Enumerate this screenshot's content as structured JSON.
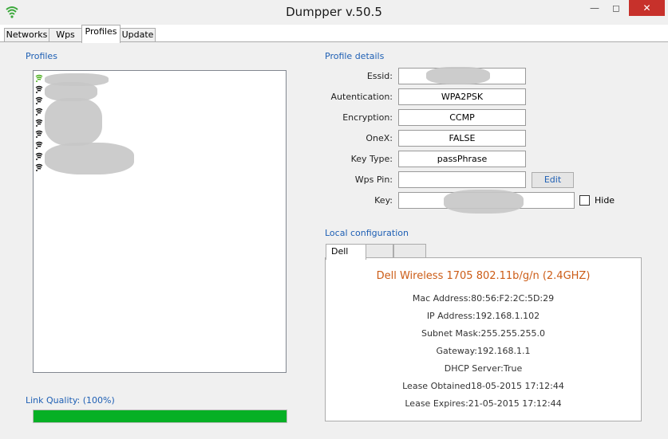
{
  "window": {
    "title": "Dumpper v.50.5",
    "min_glyph": "—",
    "max_glyph": "◻",
    "close_glyph": "✕",
    "app_icon": "wifi-signal-icon"
  },
  "tabs": [
    {
      "label": "Networks",
      "active": false
    },
    {
      "label": "Wps",
      "active": false
    },
    {
      "label": "Profiles",
      "active": true
    },
    {
      "label": "Update",
      "active": false
    }
  ],
  "profiles": {
    "label": "Profiles",
    "item_icon": "wifi-signal-icon",
    "items_count_visible": 9
  },
  "profile_details": {
    "label": "Profile details",
    "fields": [
      {
        "label": "Essid:",
        "value": ""
      },
      {
        "label": "Autentication:",
        "value": "WPA2PSK"
      },
      {
        "label": "Encryption:",
        "value": "CCMP"
      },
      {
        "label": "OneX:",
        "value": "FALSE"
      },
      {
        "label": "Key Type:",
        "value": "passPhrase"
      },
      {
        "label": "Wps Pin:",
        "value": ""
      },
      {
        "label": "Key:",
        "value": ""
      }
    ],
    "edit_label": "Edit",
    "hide_label": "Hide"
  },
  "local_config": {
    "label": "Local configuration",
    "tabs": [
      "Dell",
      "",
      ""
    ],
    "adapter": "Dell Wireless 1705 802.11b/g/n (2.4GHZ)",
    "rows": [
      "Mac Address:80:56:F2:2C:5D:29",
      "IP Address:192.168.1.102",
      "Subnet Mask:255.255.255.0",
      "Gateway:192.168.1.1",
      "DHCP Server:True",
      "Lease Obtained18-05-2015 17:12:44",
      "Lease Expires:21-05-2015 17:12:44"
    ]
  },
  "link_quality": {
    "label": "Link Quality: (100%)",
    "percent": 100,
    "color": "#06b025"
  },
  "colors": {
    "accent": "#1e5fb4",
    "adapter_text": "#cc5c16",
    "close_button": "#c7312b"
  }
}
